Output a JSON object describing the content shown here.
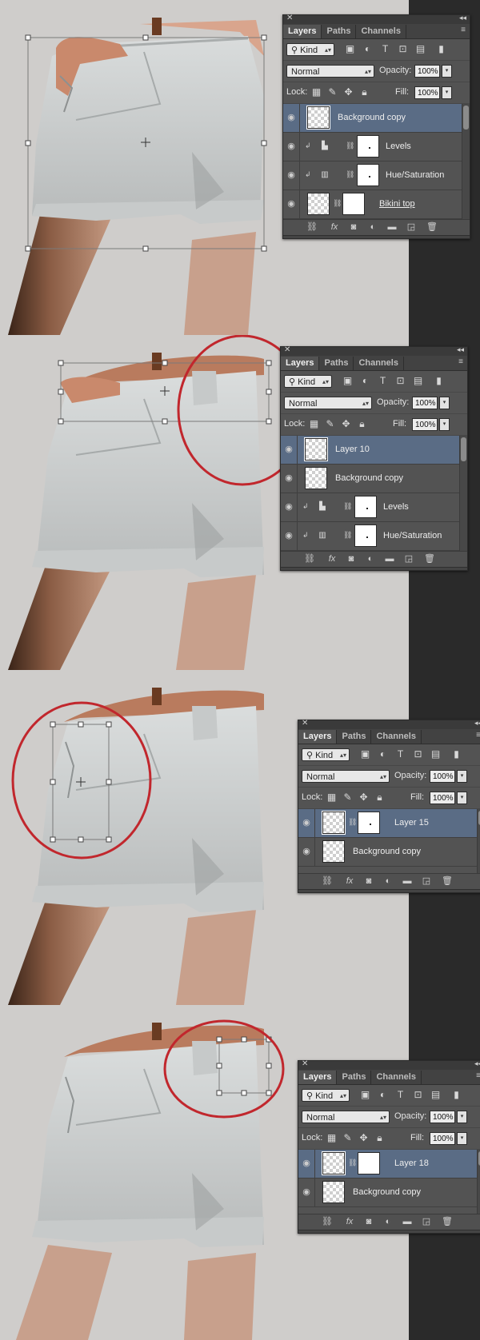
{
  "panels": [
    {
      "tabs": [
        "Layers",
        "Paths",
        "Channels"
      ],
      "filter_kind": "Kind",
      "blend_mode": "Normal",
      "opacity_label": "Opacity:",
      "opacity_value": "100%",
      "lock_label": "Lock:",
      "fill_label": "Fill:",
      "fill_value": "100%",
      "layers": [
        "Background copy",
        "Levels",
        "Hue/Saturation",
        "Bikini top"
      ]
    },
    {
      "tabs": [
        "Layers",
        "Paths",
        "Channels"
      ],
      "filter_kind": "Kind",
      "blend_mode": "Normal",
      "opacity_label": "Opacity:",
      "opacity_value": "100%",
      "lock_label": "Lock:",
      "fill_label": "Fill:",
      "fill_value": "100%",
      "layers": [
        "Layer 10",
        "Background copy",
        "Levels",
        "Hue/Saturation"
      ]
    },
    {
      "tabs": [
        "Layers",
        "Paths",
        "Channels"
      ],
      "filter_kind": "Kind",
      "blend_mode": "Normal",
      "opacity_label": "Opacity:",
      "opacity_value": "100%",
      "lock_label": "Lock:",
      "fill_label": "Fill:",
      "fill_value": "100%",
      "layers": [
        "Layer 15",
        "Background copy"
      ]
    },
    {
      "tabs": [
        "Layers",
        "Paths",
        "Channels"
      ],
      "filter_kind": "Kind",
      "blend_mode": "Normal",
      "opacity_label": "Opacity:",
      "opacity_value": "100%",
      "lock_label": "Lock:",
      "fill_label": "Fill:",
      "fill_value": "100%",
      "layers": [
        "Layer 18",
        "Background copy"
      ]
    }
  ]
}
